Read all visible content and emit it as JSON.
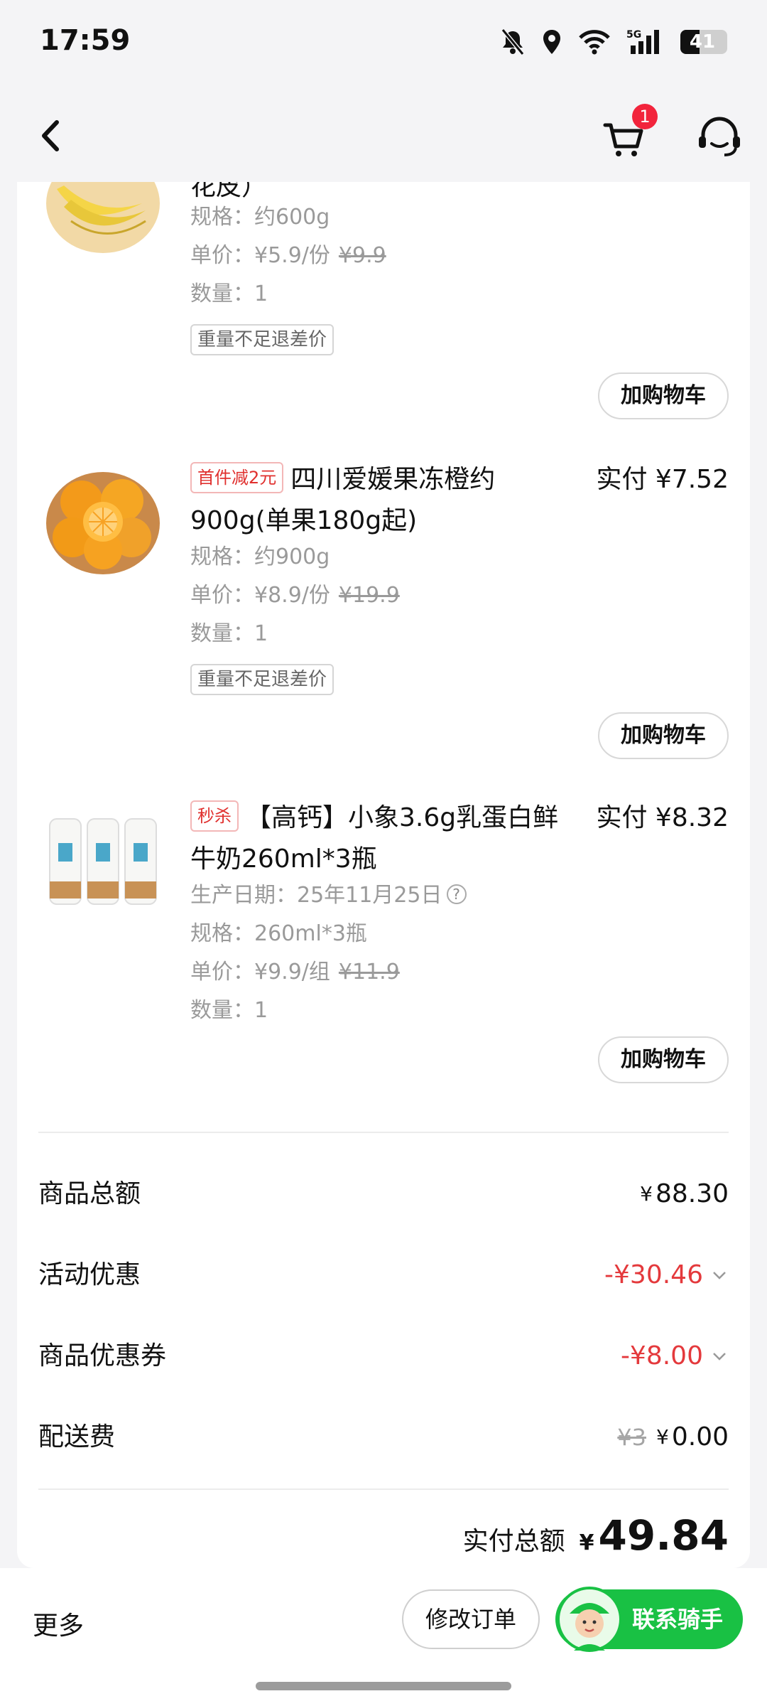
{
  "status_bar": {
    "time": "17:59",
    "battery": "41",
    "network": "5G"
  },
  "header": {
    "cart_count": "1"
  },
  "products": [
    {
      "title_tail": "花皮）",
      "spec": "规格：约600g",
      "unit_price": "单价：¥5.9/份",
      "original_price": "¥9.9",
      "quantity": "数量：1",
      "refund_tag": "重量不足退差价",
      "add_cart": "加购物车"
    },
    {
      "tag": "首件减2元",
      "title": "四川爱媛果冻橙约900g(单果180g起)",
      "paid": "实付 ¥7.52",
      "spec": "规格：约900g",
      "unit_price": "单价：¥8.9/份",
      "original_price": "¥19.9",
      "quantity": "数量：1",
      "refund_tag": "重量不足退差价",
      "add_cart": "加购物车"
    },
    {
      "tag": "秒杀",
      "title": "【高钙】小象3.6g乳蛋白鲜牛奶260ml*3瓶",
      "paid": "实付 ¥8.32",
      "production_date": "生产日期：25年11月25日",
      "spec": "规格：260ml*3瓶",
      "unit_price": "单价：¥9.9/组",
      "original_price": "¥11.9",
      "quantity": "数量：1",
      "add_cart": "加购物车"
    }
  ],
  "summary": {
    "goods_total_label": "商品总额",
    "goods_total_value": "88.30",
    "activity_label": "活动优惠",
    "activity_value": "-¥30.46",
    "coupon_label": "商品优惠券",
    "coupon_value": "-¥8.00",
    "delivery_label": "配送费",
    "delivery_old": "¥3",
    "delivery_value": "0.00",
    "currency": "¥",
    "total_label": "实付总额",
    "total_value": "49.84"
  },
  "bottom_bar": {
    "more": "更多",
    "modify_order": "修改订单",
    "contact_rider": "联系骑手"
  },
  "colors": {
    "accent_red": "#e4393c",
    "green": "#19c144",
    "badge_red": "#f2243c"
  }
}
